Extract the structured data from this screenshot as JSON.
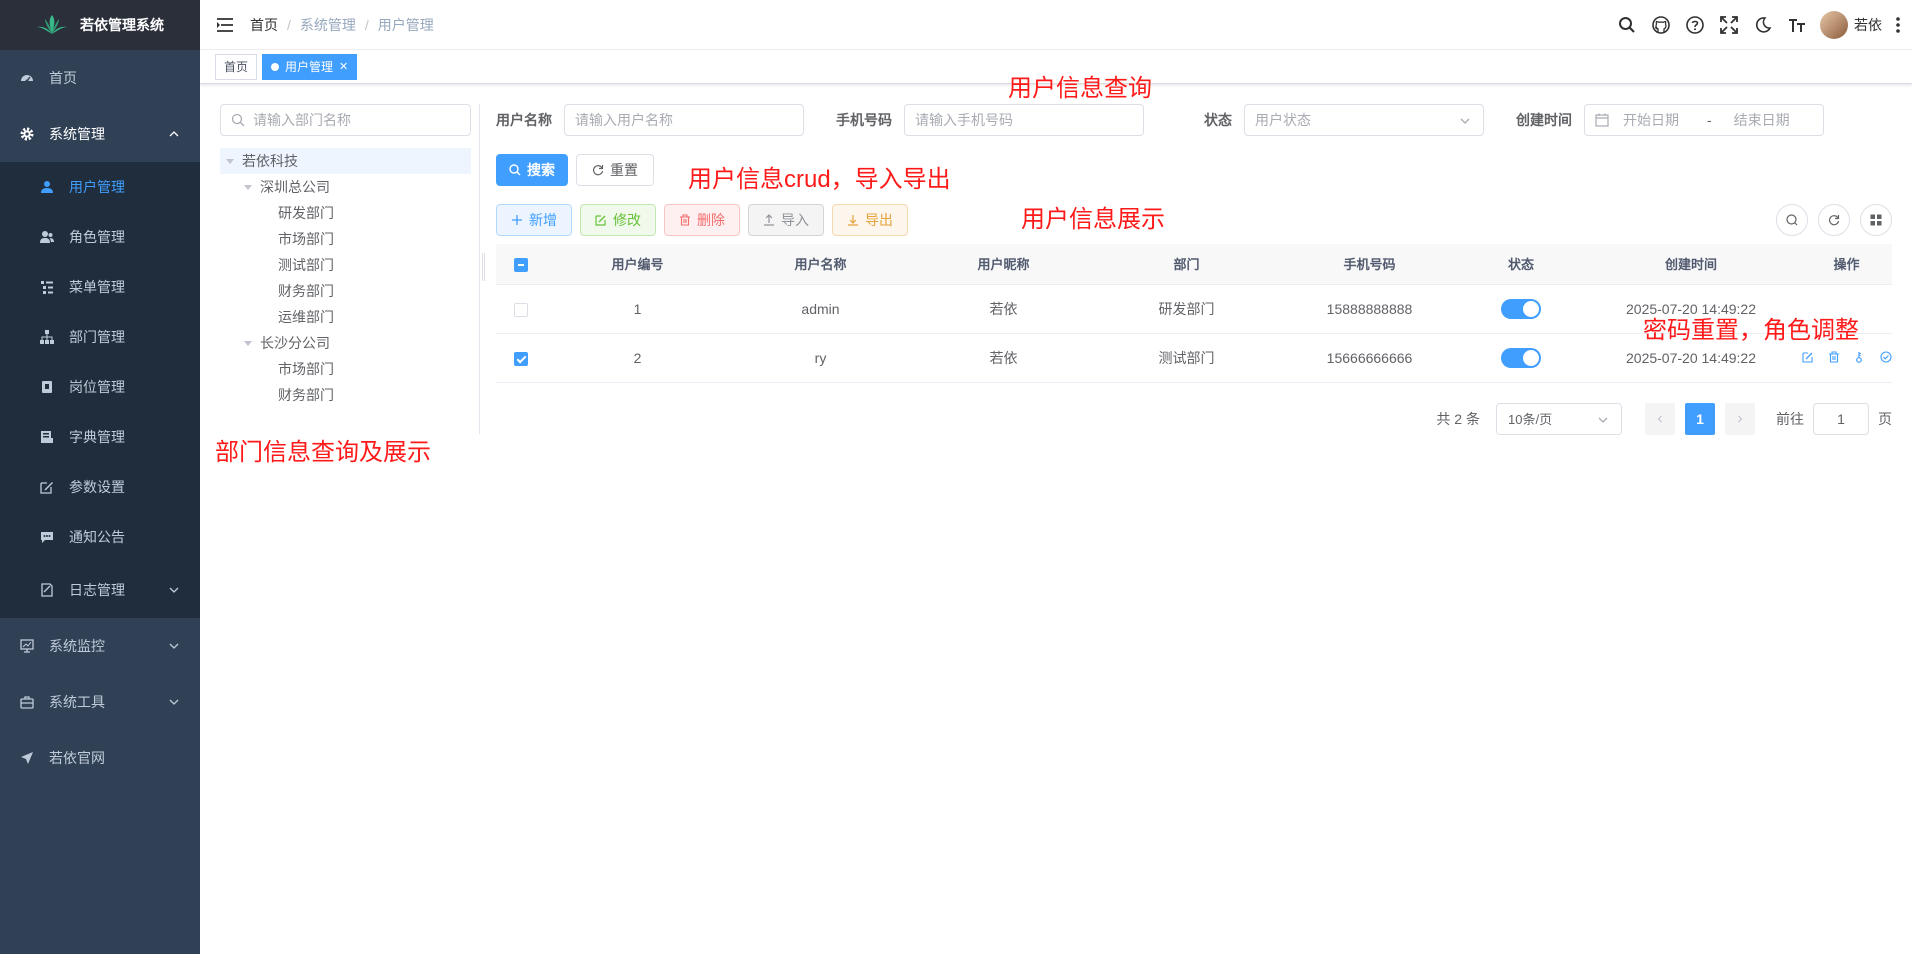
{
  "app": {
    "title": "若依管理系统"
  },
  "sidebar": {
    "items": [
      {
        "label": "首页"
      },
      {
        "label": "系统管理"
      },
      {
        "label": "系统监控"
      },
      {
        "label": "系统工具"
      },
      {
        "label": "若依官网"
      }
    ],
    "system_sub": [
      {
        "label": "用户管理"
      },
      {
        "label": "角色管理"
      },
      {
        "label": "菜单管理"
      },
      {
        "label": "部门管理"
      },
      {
        "label": "岗位管理"
      },
      {
        "label": "字典管理"
      },
      {
        "label": "参数设置"
      },
      {
        "label": "通知公告"
      },
      {
        "label": "日志管理"
      }
    ]
  },
  "navbar": {
    "breadcrumb": [
      "首页",
      "系统管理",
      "用户管理"
    ],
    "username": "若依"
  },
  "tags": [
    {
      "label": "首页"
    },
    {
      "label": "用户管理"
    }
  ],
  "dept_tree": {
    "search_placeholder": "请输入部门名称",
    "nodes": [
      "若依科技",
      "深圳总公司",
      "研发部门",
      "市场部门",
      "测试部门",
      "财务部门",
      "运维部门",
      "长沙分公司",
      "市场部门",
      "财务部门"
    ]
  },
  "query": {
    "username_label": "用户名称",
    "username_placeholder": "请输入用户名称",
    "phone_label": "手机号码",
    "phone_placeholder": "请输入手机号码",
    "status_label": "状态",
    "status_placeholder": "用户状态",
    "created_label": "创建时间",
    "start_placeholder": "开始日期",
    "range_sep": "-",
    "end_placeholder": "结束日期",
    "search_btn": "搜索",
    "reset_btn": "重置"
  },
  "toolbar": {
    "add": "新增",
    "edit": "修改",
    "delete": "删除",
    "import": "导入",
    "export": "导出"
  },
  "table": {
    "columns": [
      "用户编号",
      "用户名称",
      "用户昵称",
      "部门",
      "手机号码",
      "状态",
      "创建时间",
      "操作"
    ],
    "rows": [
      {
        "id": "1",
        "username": "admin",
        "nickname": "若依",
        "dept": "研发部门",
        "phone": "15888888888",
        "status": true,
        "created": "2025-07-20 14:49:22",
        "checked": false
      },
      {
        "id": "2",
        "username": "ry",
        "nickname": "若依",
        "dept": "测试部门",
        "phone": "15666666666",
        "status": true,
        "created": "2025-07-20 14:49:22",
        "checked": true
      }
    ]
  },
  "pagination": {
    "total": "共 2 条",
    "page_size": "10条/页",
    "current": "1",
    "goto_label": "前往",
    "goto_value": "1",
    "page_suffix": "页"
  },
  "annotations": {
    "query": "用户信息查询",
    "crud": "用户信息crud，导入导出",
    "display": "用户信息展示",
    "reset_role": "密码重置，角色调整",
    "dept": "部门信息查询及展示"
  },
  "colors": {
    "primary": "#409eff",
    "sidebar_bg": "#304156",
    "annotation": "#ff1a1a"
  }
}
